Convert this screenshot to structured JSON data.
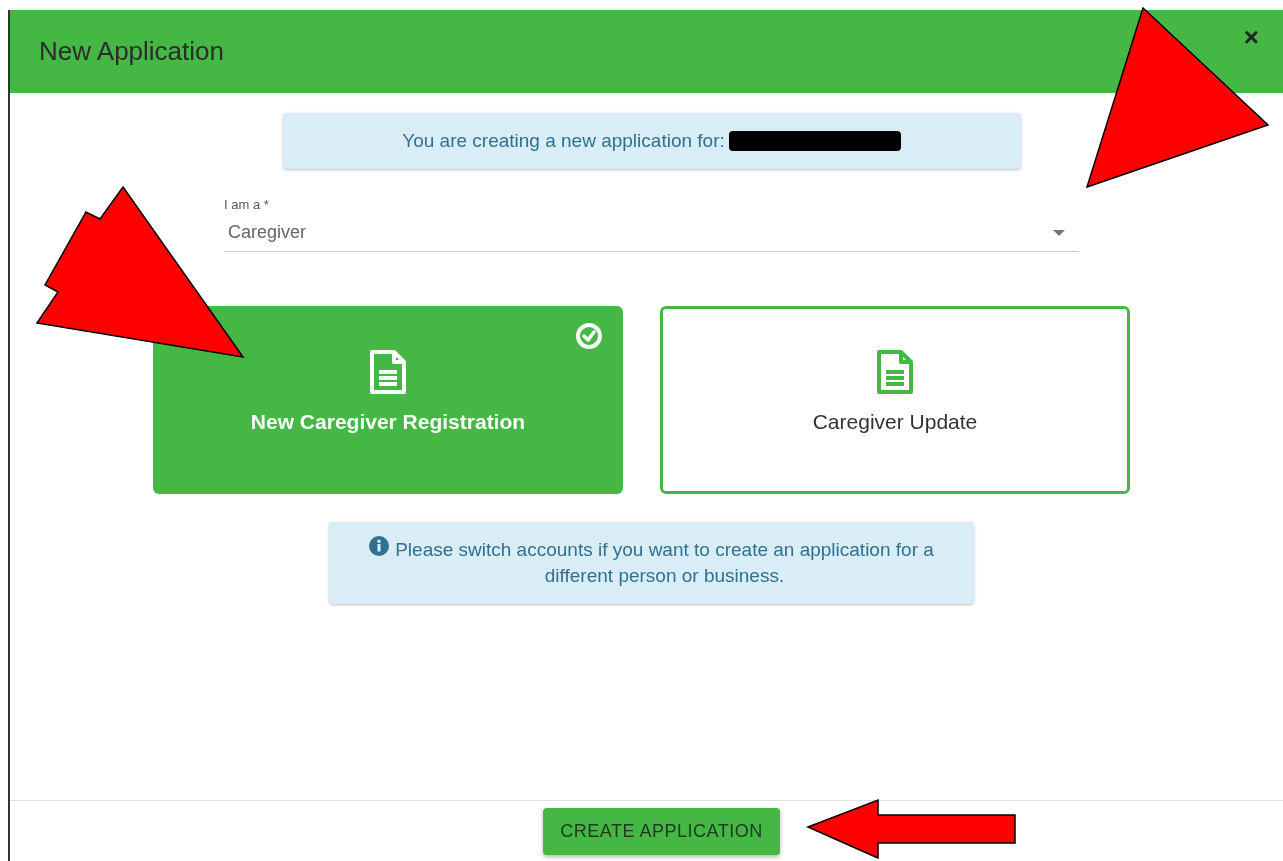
{
  "window": {
    "title": "New Application",
    "close": "×"
  },
  "notice": "You are creating a new application for:",
  "role_field": {
    "label": "I am a *",
    "value": "Caregiver"
  },
  "options": [
    {
      "label": "New Caregiver Registration",
      "selected": true
    },
    {
      "label": "Caregiver Update",
      "selected": false
    }
  ],
  "info": "Please switch accounts if you want to create an application for a different person or business.",
  "buttons": [
    "CREATE APPLICATION"
  ]
}
